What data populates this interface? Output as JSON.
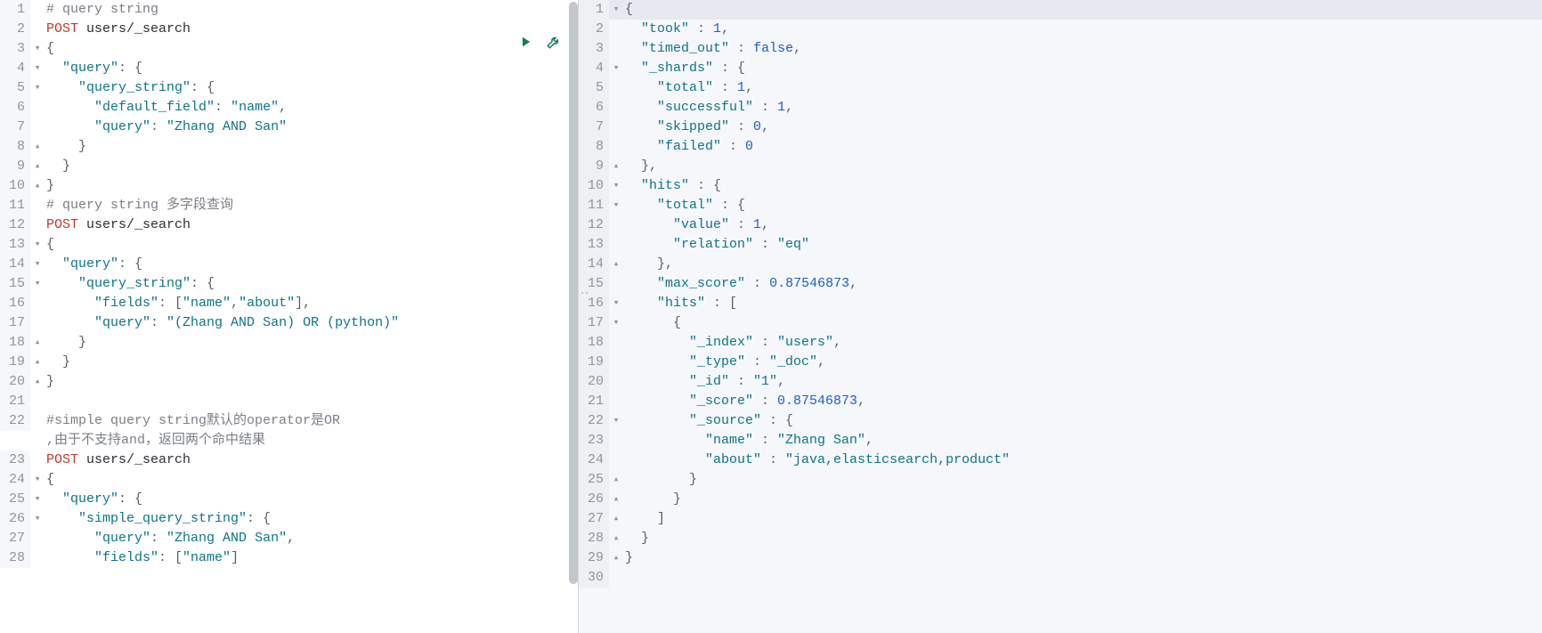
{
  "left": {
    "action_icons": {
      "run": "run-icon",
      "wrench": "wrench-icon"
    },
    "lines": [
      {
        "n": 1,
        "fold": "",
        "tokens": [
          {
            "t": "comment",
            "v": "# query string"
          }
        ]
      },
      {
        "n": 2,
        "fold": "",
        "tokens": [
          {
            "t": "kw",
            "v": "POST"
          },
          {
            "t": "txt",
            "v": " users/_search"
          }
        ]
      },
      {
        "n": 3,
        "fold": "▾",
        "tokens": [
          {
            "t": "punct",
            "v": "{"
          }
        ]
      },
      {
        "n": 4,
        "fold": "▾",
        "tokens": [
          {
            "t": "txt",
            "v": "  "
          },
          {
            "t": "key",
            "v": "\"query\""
          },
          {
            "t": "punct",
            "v": ": {"
          }
        ]
      },
      {
        "n": 5,
        "fold": "▾",
        "tokens": [
          {
            "t": "txt",
            "v": "    "
          },
          {
            "t": "key",
            "v": "\"query_string\""
          },
          {
            "t": "punct",
            "v": ": {"
          }
        ]
      },
      {
        "n": 6,
        "fold": "",
        "tokens": [
          {
            "t": "txt",
            "v": "      "
          },
          {
            "t": "key",
            "v": "\"default_field\""
          },
          {
            "t": "punct",
            "v": ": "
          },
          {
            "t": "str",
            "v": "\"name\""
          },
          {
            "t": "punct",
            "v": ","
          }
        ]
      },
      {
        "n": 7,
        "fold": "",
        "tokens": [
          {
            "t": "txt",
            "v": "      "
          },
          {
            "t": "key",
            "v": "\"query\""
          },
          {
            "t": "punct",
            "v": ": "
          },
          {
            "t": "str",
            "v": "\"Zhang AND San\""
          }
        ]
      },
      {
        "n": 8,
        "fold": "▴",
        "tokens": [
          {
            "t": "txt",
            "v": "    "
          },
          {
            "t": "punct",
            "v": "}"
          }
        ]
      },
      {
        "n": 9,
        "fold": "▴",
        "tokens": [
          {
            "t": "txt",
            "v": "  "
          },
          {
            "t": "punct",
            "v": "}"
          }
        ]
      },
      {
        "n": 10,
        "fold": "▴",
        "tokens": [
          {
            "t": "punct",
            "v": "}"
          }
        ]
      },
      {
        "n": 11,
        "fold": "",
        "tokens": [
          {
            "t": "comment",
            "v": "# query string "
          },
          {
            "t": "comment",
            "v": "多字段查询"
          }
        ]
      },
      {
        "n": 12,
        "fold": "",
        "tokens": [
          {
            "t": "kw",
            "v": "POST"
          },
          {
            "t": "txt",
            "v": " users/_search"
          }
        ]
      },
      {
        "n": 13,
        "fold": "▾",
        "tokens": [
          {
            "t": "punct",
            "v": "{"
          }
        ]
      },
      {
        "n": 14,
        "fold": "▾",
        "tokens": [
          {
            "t": "txt",
            "v": "  "
          },
          {
            "t": "key",
            "v": "\"query\""
          },
          {
            "t": "punct",
            "v": ": {"
          }
        ]
      },
      {
        "n": 15,
        "fold": "▾",
        "tokens": [
          {
            "t": "txt",
            "v": "    "
          },
          {
            "t": "key",
            "v": "\"query_string\""
          },
          {
            "t": "punct",
            "v": ": {"
          }
        ]
      },
      {
        "n": 16,
        "fold": "",
        "tokens": [
          {
            "t": "txt",
            "v": "      "
          },
          {
            "t": "key",
            "v": "\"fields\""
          },
          {
            "t": "punct",
            "v": ": ["
          },
          {
            "t": "str",
            "v": "\"name\""
          },
          {
            "t": "punct",
            "v": ","
          },
          {
            "t": "str",
            "v": "\"about\""
          },
          {
            "t": "punct",
            "v": "],"
          }
        ]
      },
      {
        "n": 17,
        "fold": "",
        "tokens": [
          {
            "t": "txt",
            "v": "      "
          },
          {
            "t": "key",
            "v": "\"query\""
          },
          {
            "t": "punct",
            "v": ": "
          },
          {
            "t": "str",
            "v": "\"(Zhang AND San) OR (python)\""
          }
        ]
      },
      {
        "n": 18,
        "fold": "▴",
        "tokens": [
          {
            "t": "txt",
            "v": "    "
          },
          {
            "t": "punct",
            "v": "}"
          }
        ]
      },
      {
        "n": 19,
        "fold": "▴",
        "tokens": [
          {
            "t": "txt",
            "v": "  "
          },
          {
            "t": "punct",
            "v": "}"
          }
        ]
      },
      {
        "n": 20,
        "fold": "▴",
        "tokens": [
          {
            "t": "punct",
            "v": "}"
          }
        ]
      },
      {
        "n": 21,
        "fold": "",
        "tokens": []
      },
      {
        "n": 22,
        "fold": "",
        "tokens": [
          {
            "t": "comment",
            "v": "#simple query string默认的operator是OR\n,由于不支持and，返回两个命中结果"
          }
        ]
      },
      {
        "n": 23,
        "fold": "",
        "tokens": [
          {
            "t": "kw",
            "v": "POST"
          },
          {
            "t": "txt",
            "v": " users/_search"
          }
        ]
      },
      {
        "n": 24,
        "fold": "▾",
        "tokens": [
          {
            "t": "punct",
            "v": "{"
          }
        ]
      },
      {
        "n": 25,
        "fold": "▾",
        "tokens": [
          {
            "t": "txt",
            "v": "  "
          },
          {
            "t": "key",
            "v": "\"query\""
          },
          {
            "t": "punct",
            "v": ": {"
          }
        ]
      },
      {
        "n": 26,
        "fold": "▾",
        "tokens": [
          {
            "t": "txt",
            "v": "    "
          },
          {
            "t": "key",
            "v": "\"simple_query_string\""
          },
          {
            "t": "punct",
            "v": ": {"
          }
        ]
      },
      {
        "n": 27,
        "fold": "",
        "tokens": [
          {
            "t": "txt",
            "v": "      "
          },
          {
            "t": "key",
            "v": "\"query\""
          },
          {
            "t": "punct",
            "v": ": "
          },
          {
            "t": "str",
            "v": "\"Zhang AND San\""
          },
          {
            "t": "punct",
            "v": ","
          }
        ]
      },
      {
        "n": 28,
        "fold": "",
        "tokens": [
          {
            "t": "txt",
            "v": "      "
          },
          {
            "t": "key",
            "v": "\"fields\""
          },
          {
            "t": "punct",
            "v": ": ["
          },
          {
            "t": "str",
            "v": "\"name\""
          },
          {
            "t": "punct",
            "v": "]"
          }
        ]
      }
    ]
  },
  "right": {
    "lines": [
      {
        "n": 1,
        "fold": "▾",
        "hl": true,
        "tokens": [
          {
            "t": "punct",
            "v": "{"
          }
        ]
      },
      {
        "n": 2,
        "fold": "",
        "tokens": [
          {
            "t": "txt",
            "v": "  "
          },
          {
            "t": "key",
            "v": "\"took\""
          },
          {
            "t": "punct",
            "v": " : "
          },
          {
            "t": "num",
            "v": "1"
          },
          {
            "t": "punct",
            "v": ","
          }
        ]
      },
      {
        "n": 3,
        "fold": "",
        "tokens": [
          {
            "t": "txt",
            "v": "  "
          },
          {
            "t": "key",
            "v": "\"timed_out\""
          },
          {
            "t": "punct",
            "v": " : "
          },
          {
            "t": "bool",
            "v": "false"
          },
          {
            "t": "punct",
            "v": ","
          }
        ]
      },
      {
        "n": 4,
        "fold": "▾",
        "tokens": [
          {
            "t": "txt",
            "v": "  "
          },
          {
            "t": "key",
            "v": "\"_shards\""
          },
          {
            "t": "punct",
            "v": " : {"
          }
        ]
      },
      {
        "n": 5,
        "fold": "",
        "tokens": [
          {
            "t": "txt",
            "v": "    "
          },
          {
            "t": "key",
            "v": "\"total\""
          },
          {
            "t": "punct",
            "v": " : "
          },
          {
            "t": "num",
            "v": "1"
          },
          {
            "t": "punct",
            "v": ","
          }
        ]
      },
      {
        "n": 6,
        "fold": "",
        "tokens": [
          {
            "t": "txt",
            "v": "    "
          },
          {
            "t": "key",
            "v": "\"successful\""
          },
          {
            "t": "punct",
            "v": " : "
          },
          {
            "t": "num",
            "v": "1"
          },
          {
            "t": "punct",
            "v": ","
          }
        ]
      },
      {
        "n": 7,
        "fold": "",
        "tokens": [
          {
            "t": "txt",
            "v": "    "
          },
          {
            "t": "key",
            "v": "\"skipped\""
          },
          {
            "t": "punct",
            "v": " : "
          },
          {
            "t": "num",
            "v": "0"
          },
          {
            "t": "punct",
            "v": ","
          }
        ]
      },
      {
        "n": 8,
        "fold": "",
        "tokens": [
          {
            "t": "txt",
            "v": "    "
          },
          {
            "t": "key",
            "v": "\"failed\""
          },
          {
            "t": "punct",
            "v": " : "
          },
          {
            "t": "num",
            "v": "0"
          }
        ]
      },
      {
        "n": 9,
        "fold": "▴",
        "tokens": [
          {
            "t": "txt",
            "v": "  "
          },
          {
            "t": "punct",
            "v": "},"
          }
        ]
      },
      {
        "n": 10,
        "fold": "▾",
        "tokens": [
          {
            "t": "txt",
            "v": "  "
          },
          {
            "t": "key",
            "v": "\"hits\""
          },
          {
            "t": "punct",
            "v": " : {"
          }
        ]
      },
      {
        "n": 11,
        "fold": "▾",
        "tokens": [
          {
            "t": "txt",
            "v": "    "
          },
          {
            "t": "key",
            "v": "\"total\""
          },
          {
            "t": "punct",
            "v": " : {"
          }
        ]
      },
      {
        "n": 12,
        "fold": "",
        "tokens": [
          {
            "t": "txt",
            "v": "      "
          },
          {
            "t": "key",
            "v": "\"value\""
          },
          {
            "t": "punct",
            "v": " : "
          },
          {
            "t": "num",
            "v": "1"
          },
          {
            "t": "punct",
            "v": ","
          }
        ]
      },
      {
        "n": 13,
        "fold": "",
        "tokens": [
          {
            "t": "txt",
            "v": "      "
          },
          {
            "t": "key",
            "v": "\"relation\""
          },
          {
            "t": "punct",
            "v": " : "
          },
          {
            "t": "str",
            "v": "\"eq\""
          }
        ]
      },
      {
        "n": 14,
        "fold": "▴",
        "tokens": [
          {
            "t": "txt",
            "v": "    "
          },
          {
            "t": "punct",
            "v": "},"
          }
        ]
      },
      {
        "n": 15,
        "fold": "",
        "tokens": [
          {
            "t": "txt",
            "v": "    "
          },
          {
            "t": "key",
            "v": "\"max_score\""
          },
          {
            "t": "punct",
            "v": " : "
          },
          {
            "t": "num",
            "v": "0.87546873"
          },
          {
            "t": "punct",
            "v": ","
          }
        ]
      },
      {
        "n": 16,
        "fold": "▾",
        "tokens": [
          {
            "t": "txt",
            "v": "    "
          },
          {
            "t": "key",
            "v": "\"hits\""
          },
          {
            "t": "punct",
            "v": " : ["
          }
        ]
      },
      {
        "n": 17,
        "fold": "▾",
        "tokens": [
          {
            "t": "txt",
            "v": "      "
          },
          {
            "t": "punct",
            "v": "{"
          }
        ]
      },
      {
        "n": 18,
        "fold": "",
        "tokens": [
          {
            "t": "txt",
            "v": "        "
          },
          {
            "t": "key",
            "v": "\"_index\""
          },
          {
            "t": "punct",
            "v": " : "
          },
          {
            "t": "str",
            "v": "\"users\""
          },
          {
            "t": "punct",
            "v": ","
          }
        ]
      },
      {
        "n": 19,
        "fold": "",
        "tokens": [
          {
            "t": "txt",
            "v": "        "
          },
          {
            "t": "key",
            "v": "\"_type\""
          },
          {
            "t": "punct",
            "v": " : "
          },
          {
            "t": "str",
            "v": "\"_doc\""
          },
          {
            "t": "punct",
            "v": ","
          }
        ]
      },
      {
        "n": 20,
        "fold": "",
        "tokens": [
          {
            "t": "txt",
            "v": "        "
          },
          {
            "t": "key",
            "v": "\"_id\""
          },
          {
            "t": "punct",
            "v": " : "
          },
          {
            "t": "str",
            "v": "\"1\""
          },
          {
            "t": "punct",
            "v": ","
          }
        ]
      },
      {
        "n": 21,
        "fold": "",
        "tokens": [
          {
            "t": "txt",
            "v": "        "
          },
          {
            "t": "key",
            "v": "\"_score\""
          },
          {
            "t": "punct",
            "v": " : "
          },
          {
            "t": "num",
            "v": "0.87546873"
          },
          {
            "t": "punct",
            "v": ","
          }
        ]
      },
      {
        "n": 22,
        "fold": "▾",
        "tokens": [
          {
            "t": "txt",
            "v": "        "
          },
          {
            "t": "key",
            "v": "\"_source\""
          },
          {
            "t": "punct",
            "v": " : {"
          }
        ]
      },
      {
        "n": 23,
        "fold": "",
        "tokens": [
          {
            "t": "txt",
            "v": "          "
          },
          {
            "t": "key",
            "v": "\"name\""
          },
          {
            "t": "punct",
            "v": " : "
          },
          {
            "t": "str",
            "v": "\"Zhang San\""
          },
          {
            "t": "punct",
            "v": ","
          }
        ]
      },
      {
        "n": 24,
        "fold": "",
        "tokens": [
          {
            "t": "txt",
            "v": "          "
          },
          {
            "t": "key",
            "v": "\"about\""
          },
          {
            "t": "punct",
            "v": " : "
          },
          {
            "t": "str",
            "v": "\"java,elasticsearch,product\""
          }
        ]
      },
      {
        "n": 25,
        "fold": "▴",
        "tokens": [
          {
            "t": "txt",
            "v": "        "
          },
          {
            "t": "punct",
            "v": "}"
          }
        ]
      },
      {
        "n": 26,
        "fold": "▴",
        "tokens": [
          {
            "t": "txt",
            "v": "      "
          },
          {
            "t": "punct",
            "v": "}"
          }
        ]
      },
      {
        "n": 27,
        "fold": "▴",
        "tokens": [
          {
            "t": "txt",
            "v": "    "
          },
          {
            "t": "punct",
            "v": "]"
          }
        ]
      },
      {
        "n": 28,
        "fold": "▴",
        "tokens": [
          {
            "t": "txt",
            "v": "  "
          },
          {
            "t": "punct",
            "v": "}"
          }
        ]
      },
      {
        "n": 29,
        "fold": "▴",
        "tokens": [
          {
            "t": "punct",
            "v": "}"
          }
        ]
      },
      {
        "n": 30,
        "fold": "",
        "tokens": []
      }
    ]
  }
}
